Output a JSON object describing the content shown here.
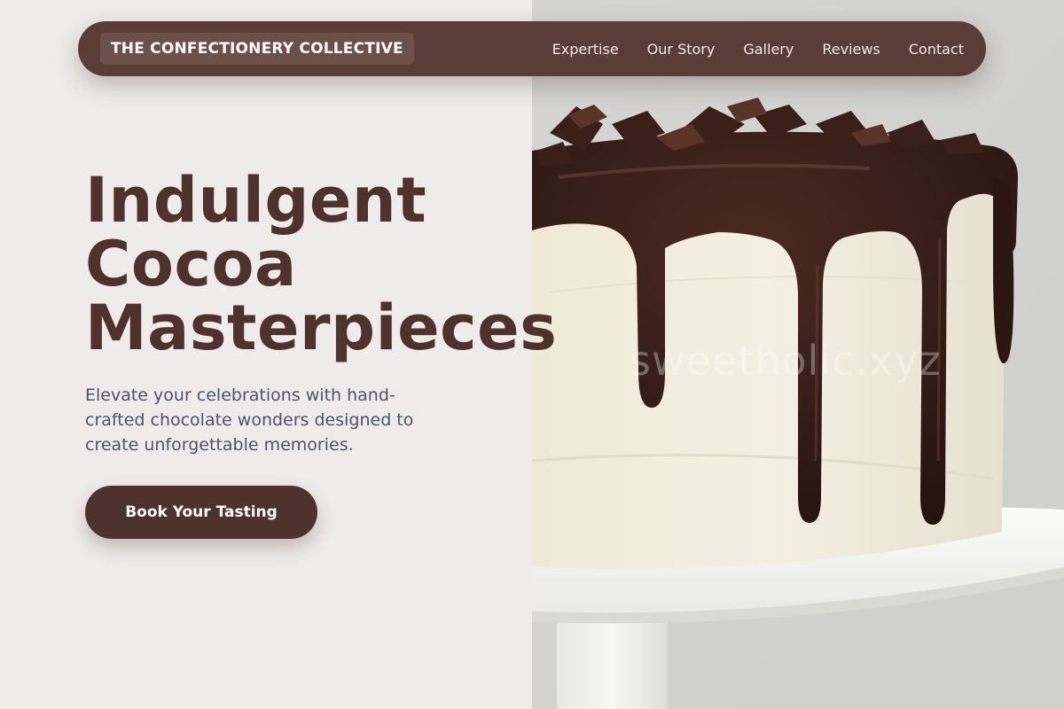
{
  "brand": {
    "name": "THE CONFECTIONERY COLLECTIVE"
  },
  "nav": {
    "items": [
      {
        "label": "Expertise"
      },
      {
        "label": "Our Story"
      },
      {
        "label": "Gallery"
      },
      {
        "label": "Reviews"
      },
      {
        "label": "Contact"
      }
    ]
  },
  "hero": {
    "headline": [
      "Indulgent",
      "Cocoa",
      "Masterpieces"
    ],
    "subtitle": "Elevate your celebrations with hand-crafted chocolate wonders designed to create unforgettable memories.",
    "cta_label": "Book Your Tasting",
    "image_watermark": "sweetholic.xyz"
  },
  "colors": {
    "brand_brown": "#5b3d38",
    "headline_brown": "#4e322d",
    "background": "#efebea",
    "subtitle_gray": "#4a5668"
  }
}
